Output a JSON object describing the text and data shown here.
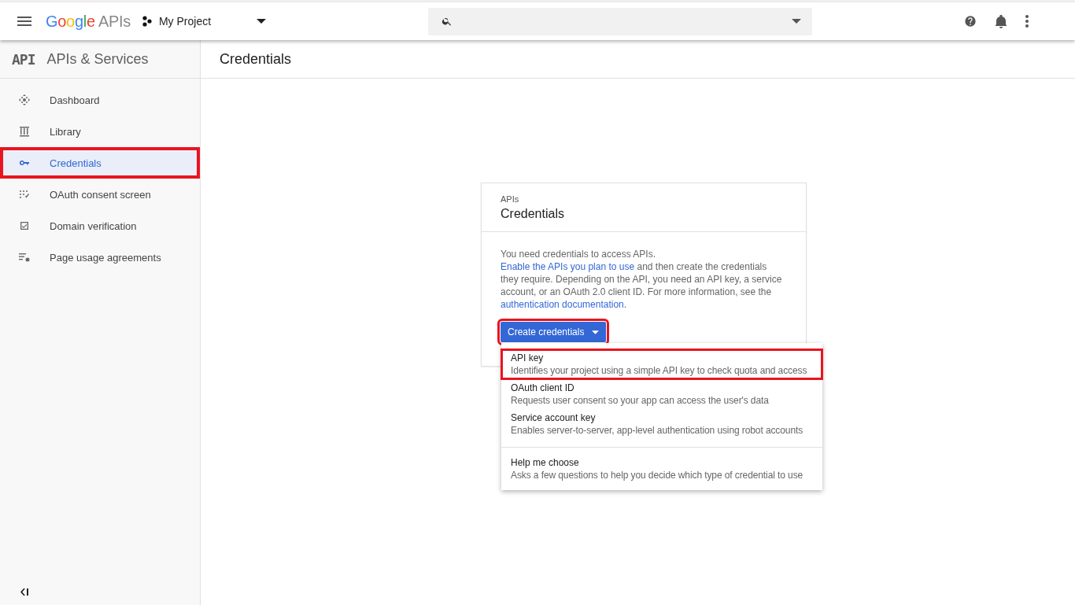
{
  "header": {
    "logo": {
      "brand": "Google",
      "product": "APIs"
    },
    "project": "My Project"
  },
  "sidebar": {
    "icon_text": "API",
    "title": "APIs & Services",
    "items": [
      {
        "label": "Dashboard",
        "selected": false,
        "highlighted": false
      },
      {
        "label": "Library",
        "selected": false,
        "highlighted": false
      },
      {
        "label": "Credentials",
        "selected": true,
        "highlighted": true
      },
      {
        "label": "OAuth consent screen",
        "selected": false,
        "highlighted": false
      },
      {
        "label": "Domain verification",
        "selected": false,
        "highlighted": false
      },
      {
        "label": "Page usage agreements",
        "selected": false,
        "highlighted": false
      }
    ]
  },
  "page_title": "Credentials",
  "card": {
    "eyebrow": "APIs",
    "title": "Credentials",
    "body": [
      {
        "kind": "text",
        "text": "You need credentials to access APIs. "
      },
      {
        "kind": "link",
        "text": "Enable the APIs you plan to use"
      },
      {
        "kind": "text",
        "text": " and then create the credentials they require. Depending on the API, you need an API key, a service account, or an OAuth 2.0 client ID. For more information, see the "
      },
      {
        "kind": "link",
        "text": "authentication documentation"
      },
      {
        "kind": "text",
        "text": "."
      }
    ],
    "button": {
      "label": "Create credentials",
      "highlighted": true
    }
  },
  "menu": {
    "expanded": true,
    "items": [
      {
        "title": "API key",
        "description": "Identifies your project using a simple API key to check quota and access",
        "highlighted": true,
        "divider_before": false
      },
      {
        "title": "OAuth client ID",
        "description": "Requests user consent so your app can access the user's data",
        "highlighted": false,
        "divider_before": false
      },
      {
        "title": "Service account key",
        "description": "Enables server-to-server, app-level authentication using robot accounts",
        "highlighted": false,
        "divider_before": false
      },
      {
        "title": "Help me choose",
        "description": "Asks a few questions to help you decide which type of credential to use",
        "highlighted": false,
        "divider_before": true
      }
    ]
  }
}
